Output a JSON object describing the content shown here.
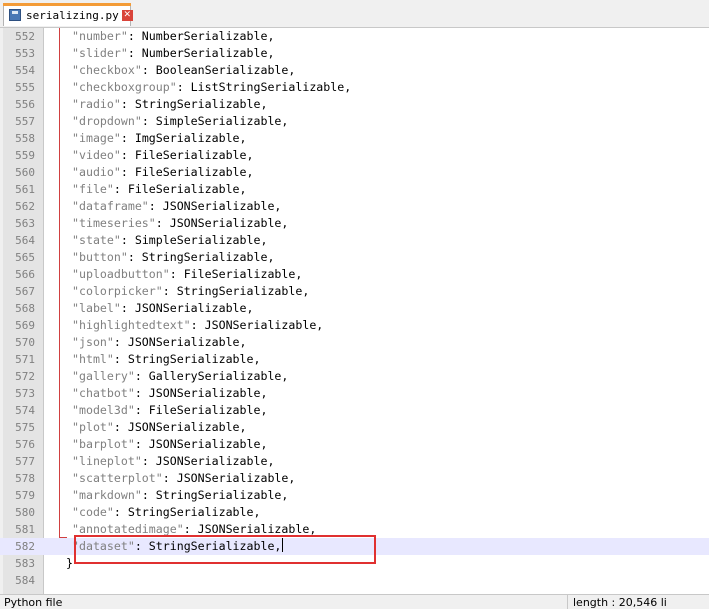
{
  "tab": {
    "title": "serializing.py",
    "close_glyph": "✕"
  },
  "editor": {
    "lines": [
      {
        "n": "552",
        "key": "\"number\"",
        "val": ": NumberSerializable,"
      },
      {
        "n": "553",
        "key": "\"slider\"",
        "val": ": NumberSerializable,"
      },
      {
        "n": "554",
        "key": "\"checkbox\"",
        "val": ": BooleanSerializable,"
      },
      {
        "n": "555",
        "key": "\"checkboxgroup\"",
        "val": ": ListStringSerializable,"
      },
      {
        "n": "556",
        "key": "\"radio\"",
        "val": ": StringSerializable,"
      },
      {
        "n": "557",
        "key": "\"dropdown\"",
        "val": ": SimpleSerializable,"
      },
      {
        "n": "558",
        "key": "\"image\"",
        "val": ": ImgSerializable,"
      },
      {
        "n": "559",
        "key": "\"video\"",
        "val": ": FileSerializable,"
      },
      {
        "n": "560",
        "key": "\"audio\"",
        "val": ": FileSerializable,"
      },
      {
        "n": "561",
        "key": "\"file\"",
        "val": ": FileSerializable,"
      },
      {
        "n": "562",
        "key": "\"dataframe\"",
        "val": ": JSONSerializable,"
      },
      {
        "n": "563",
        "key": "\"timeseries\"",
        "val": ": JSONSerializable,"
      },
      {
        "n": "564",
        "key": "\"state\"",
        "val": ": SimpleSerializable,"
      },
      {
        "n": "565",
        "key": "\"button\"",
        "val": ": StringSerializable,"
      },
      {
        "n": "566",
        "key": "\"uploadbutton\"",
        "val": ": FileSerializable,"
      },
      {
        "n": "567",
        "key": "\"colorpicker\"",
        "val": ": StringSerializable,"
      },
      {
        "n": "568",
        "key": "\"label\"",
        "val": ": JSONSerializable,"
      },
      {
        "n": "569",
        "key": "\"highlightedtext\"",
        "val": ": JSONSerializable,"
      },
      {
        "n": "570",
        "key": "\"json\"",
        "val": ": JSONSerializable,"
      },
      {
        "n": "571",
        "key": "\"html\"",
        "val": ": StringSerializable,"
      },
      {
        "n": "572",
        "key": "\"gallery\"",
        "val": ": GallerySerializable,"
      },
      {
        "n": "573",
        "key": "\"chatbot\"",
        "val": ": JSONSerializable,"
      },
      {
        "n": "574",
        "key": "\"model3d\"",
        "val": ": FileSerializable,"
      },
      {
        "n": "575",
        "key": "\"plot\"",
        "val": ": JSONSerializable,"
      },
      {
        "n": "576",
        "key": "\"barplot\"",
        "val": ": JSONSerializable,"
      },
      {
        "n": "577",
        "key": "\"lineplot\"",
        "val": ": JSONSerializable,"
      },
      {
        "n": "578",
        "key": "\"scatterplot\"",
        "val": ": JSONSerializable,"
      },
      {
        "n": "579",
        "key": "\"markdown\"",
        "val": ": StringSerializable,"
      },
      {
        "n": "580",
        "key": "\"code\"",
        "val": ": StringSerializable,"
      },
      {
        "n": "581",
        "key": "\"annotatedimage\"",
        "val": ": JSONSerializable,"
      },
      {
        "n": "582",
        "key": "\"dataset\"",
        "val": ": StringSerializable,"
      },
      {
        "n": "583",
        "key": "",
        "val": "}"
      },
      {
        "n": "584",
        "key": "",
        "val": ""
      }
    ],
    "current_line": "582"
  },
  "status": {
    "left": "Python file",
    "right": "length : 20,546    li"
  },
  "colors": {
    "fold_marker": "#d04040",
    "current_line_bg": "#e8e8ff",
    "highlight_box": "#e03030",
    "tab_accent": "#f39b37"
  }
}
